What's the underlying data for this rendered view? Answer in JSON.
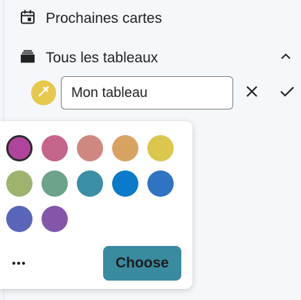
{
  "navigation": {
    "upcoming": {
      "label": "Prochaines cartes",
      "icon": "calendar-icon"
    },
    "all_boards": {
      "label": "Tous les tableaux",
      "icon": "archive-icon",
      "toggle_icon": "chevron-up-icon"
    }
  },
  "board_editor": {
    "name_value": "Mon tableau",
    "current_color": "#e6c84a",
    "color_trigger_icon": "eyedropper-icon",
    "cancel_icon": "close-icon",
    "confirm_icon": "check-icon"
  },
  "color_picker": {
    "swatches": [
      {
        "color": "#b0449b",
        "selected": true
      },
      {
        "color": "#c4658b",
        "selected": false
      },
      {
        "color": "#cf887f",
        "selected": false
      },
      {
        "color": "#d8a362",
        "selected": false
      },
      {
        "color": "#dbc64e",
        "selected": false
      },
      {
        "color": "#9db46f",
        "selected": false
      },
      {
        "color": "#6ca38a",
        "selected": false
      },
      {
        "color": "#3a8ea6",
        "selected": false
      },
      {
        "color": "#0b7ac9",
        "selected": false
      },
      {
        "color": "#2f73c3",
        "selected": false
      },
      {
        "color": "#5865b9",
        "selected": false
      },
      {
        "color": "#8456aa",
        "selected": false
      }
    ],
    "more_icon": "more-horizontal-icon",
    "choose_label": "Choose",
    "choose_color": "#3a8aa0"
  }
}
